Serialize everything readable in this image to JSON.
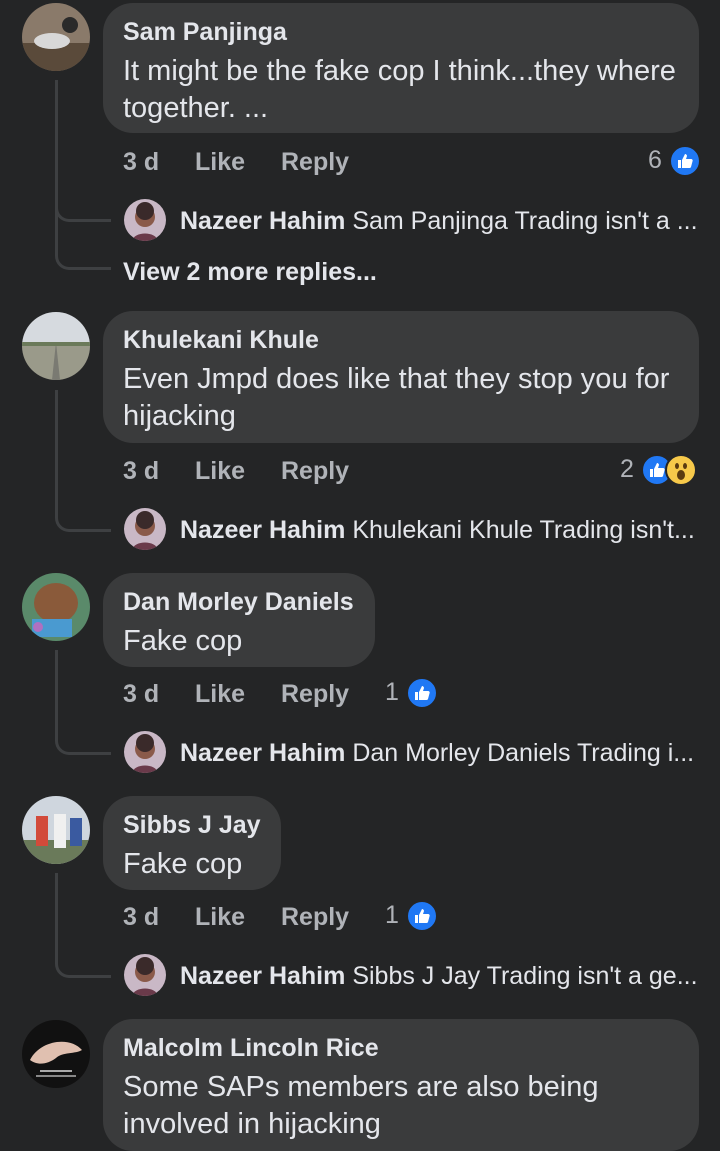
{
  "comments": [
    {
      "author": "Sam Panjinga",
      "text": "It might be the fake cop I think...they where together. ...",
      "time": "3 d",
      "like_label": "Like",
      "reply_label": "Reply",
      "reaction_count": "6",
      "reactions": [
        "like"
      ],
      "replies": [
        {
          "author": "Nazeer Hahim",
          "text": "Sam Panjinga Trading isn't a ..."
        }
      ],
      "more_replies": "View 2 more replies..."
    },
    {
      "author": "Khulekani Khule",
      "text": "Even Jmpd does like that they stop you for hijacking",
      "time": "3 d",
      "like_label": "Like",
      "reply_label": "Reply",
      "reaction_count": "2",
      "reactions": [
        "like",
        "wow"
      ],
      "replies": [
        {
          "author": "Nazeer Hahim",
          "text": "Khulekani Khule Trading isn't..."
        }
      ]
    },
    {
      "author": "Dan Morley Daniels",
      "text": "Fake cop",
      "time": "3 d",
      "like_label": "Like",
      "reply_label": "Reply",
      "reaction_count": "1",
      "reactions": [
        "like"
      ],
      "replies": [
        {
          "author": "Nazeer Hahim",
          "text": "Dan Morley Daniels Trading i..."
        }
      ]
    },
    {
      "author": "Sibbs J Jay",
      "text": "Fake cop",
      "time": "3 d",
      "like_label": "Like",
      "reply_label": "Reply",
      "reaction_count": "1",
      "reactions": [
        "like"
      ],
      "replies": [
        {
          "author": "Nazeer Hahim",
          "text": "Sibbs J Jay Trading isn't a ge..."
        }
      ]
    },
    {
      "author": "Malcolm Lincoln Rice",
      "text": "Some SAPs members are also being involved in hijacking"
    }
  ],
  "colors": {
    "background": "#242526",
    "bubble": "#3a3b3c",
    "like_blue": "#2078f4",
    "wow_yellow": "#f7c94a",
    "secondary_text": "#b0b3b8"
  }
}
